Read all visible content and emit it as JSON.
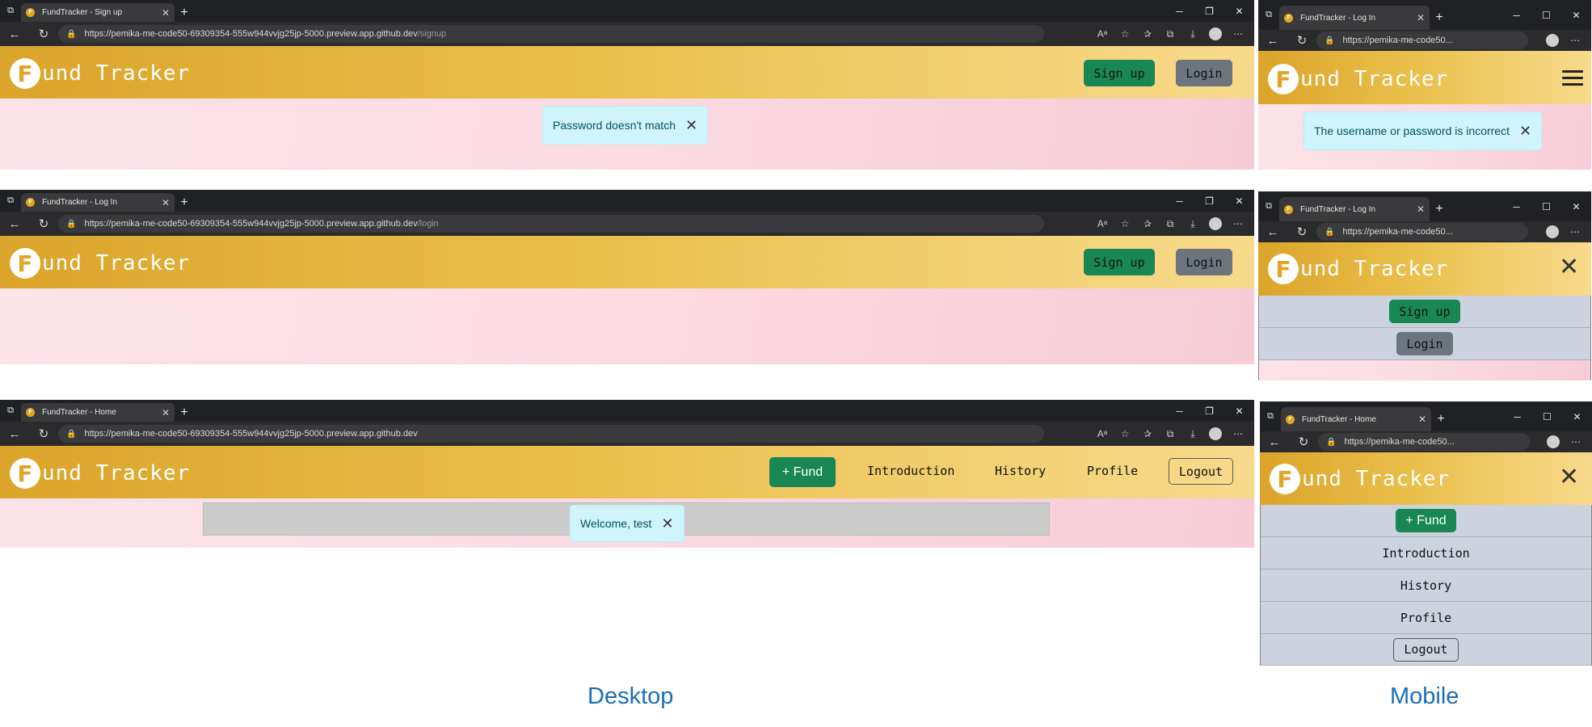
{
  "browser": {
    "new_tab_glyph": "+",
    "close_glyph": "✕",
    "tab_square_glyph": "⧉"
  },
  "site": {
    "logo_letter": "F",
    "logo_text": "und Tracker"
  },
  "desktop_signup": {
    "tab_title": "FundTracker - Sign up",
    "url_main": "https://pemika-me-code50-69309354-555w944vvjg25jp-5000.preview.app.github.dev",
    "url_path": "/signup",
    "signup_label": "Sign up",
    "login_label": "Login",
    "toast_text": "Password doesn't match"
  },
  "desktop_login": {
    "tab_title": "FundTracker - Log In",
    "url_main": "https://pemika-me-code50-69309354-555w944vvjg25jp-5000.preview.app.github.dev",
    "url_path": "/login",
    "signup_label": "Sign up",
    "login_label": "Login"
  },
  "desktop_home": {
    "tab_title": "FundTracker - Home",
    "url_main": "https://pemika-me-code50-69309354-555w944vvjg25jp-5000.preview.app.github.dev",
    "fund_label": "+ Fund",
    "intro_label": "Introduction",
    "history_label": "History",
    "profile_label": "Profile",
    "logout_label": "Logout",
    "toast_text": "Welcome, test"
  },
  "mobile_login_error": {
    "tab_title": "FundTracker - Log In",
    "url": "https://pemika-me-code50...",
    "toast_text": "The username or password is incorrect"
  },
  "mobile_login_menu": {
    "tab_title": "FundTracker - Log In",
    "url": "https://pemika-me-code50...",
    "signup_label": "Sign up",
    "login_label": "Login"
  },
  "mobile_home_menu": {
    "tab_title": "FundTracker - Home",
    "url": "https://pemika-me-code50...",
    "fund_label": "+ Fund",
    "intro_label": "Introduction",
    "history_label": "History",
    "profile_label": "Profile",
    "logout_label": "Logout"
  },
  "captions": {
    "desktop": "Desktop",
    "mobile": "Mobile"
  },
  "colors": {
    "header_start": "#dba42a",
    "header_end": "#f8da8c",
    "signup_green": "#198754",
    "login_grey": "#6c757d",
    "toast_bg": "#cff4fc",
    "menu_row": "#ccd2de",
    "caption_blue": "#1a6fb5"
  }
}
